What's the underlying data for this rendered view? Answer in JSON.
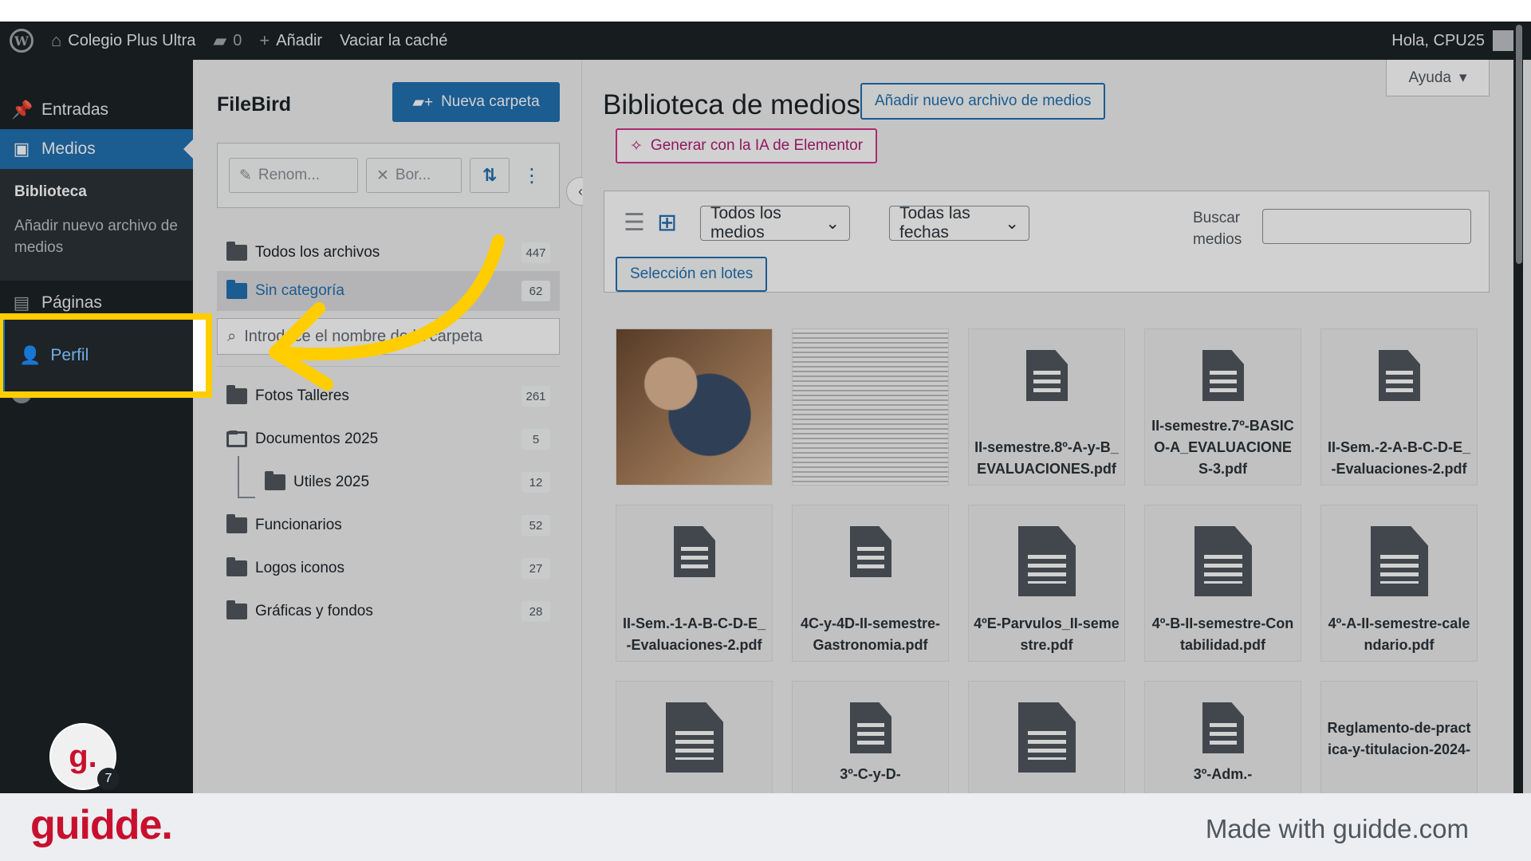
{
  "adminbar": {
    "site_name": "Colegio Plus Ultra",
    "comments_count": "0",
    "add_label": "Añadir",
    "cache_label": "Vaciar la caché",
    "greeting": "Hola, CPU25"
  },
  "sidebar": {
    "entradas": "Entradas",
    "medios": "Medios",
    "biblioteca": "Biblioteca",
    "add_media": "Añadir nuevo archivo de medios",
    "paginas": "Páginas",
    "perfil": "Perfil",
    "collapse": "Cerrar menú"
  },
  "filebird": {
    "title": "FileBird",
    "new_folder": "Nueva carpeta",
    "rename": "Renom...",
    "delete": "Bor...",
    "all_files": "Todos los archivos",
    "all_files_count": "447",
    "uncategorized": "Sin categoría",
    "uncategorized_count": "62",
    "search_placeholder": "Introduce el nombre de la carpeta",
    "folders": [
      {
        "name": "Fotos Talleres",
        "count": "261"
      },
      {
        "name": "Documentos 2025",
        "count": "5"
      },
      {
        "name": "Utiles 2025",
        "count": "12"
      },
      {
        "name": "Funcionarios",
        "count": "52"
      },
      {
        "name": "Logos iconos",
        "count": "27"
      },
      {
        "name": "Gráficas y fondos",
        "count": "28"
      }
    ]
  },
  "media": {
    "title": "Biblioteca de medios",
    "add_new": "Añadir nuevo archivo de medios",
    "help": "Ayuda",
    "ai_button": "Generar con la IA de Elementor",
    "filter_type": "Todos los medios",
    "filter_date": "Todas las fechas",
    "search_label": "Buscar medios",
    "bulk_select": "Selección en lotes",
    "files": [
      "II-semestre.8º-A-y-B_EVALUACIONES.pdf",
      "II-semestre.7º-BASICO-A_EVALUACIONES-3.pdf",
      "II-Sem.-2-A-B-C-D-E_-Evaluaciones-2.pdf",
      "II-Sem.-1-A-B-C-D-E_-Evaluaciones-2.pdf",
      "4C-y-4D-II-semestre-Gastronomia.pdf",
      "4ºE-Parvulos_II-semestre.pdf",
      "4º-B-II-semestre-Contabilidad.pdf",
      "4º-A-II-semestre-calendario.pdf",
      "3º-C-y-D-",
      "3º-Adm.-",
      "Reglamento-de-practica-y-titulacion-2024-"
    ]
  },
  "badge": {
    "letter": "g.",
    "count": "7"
  },
  "footer": {
    "logo": "guidde.",
    "made_with": "Made with guidde.com"
  }
}
